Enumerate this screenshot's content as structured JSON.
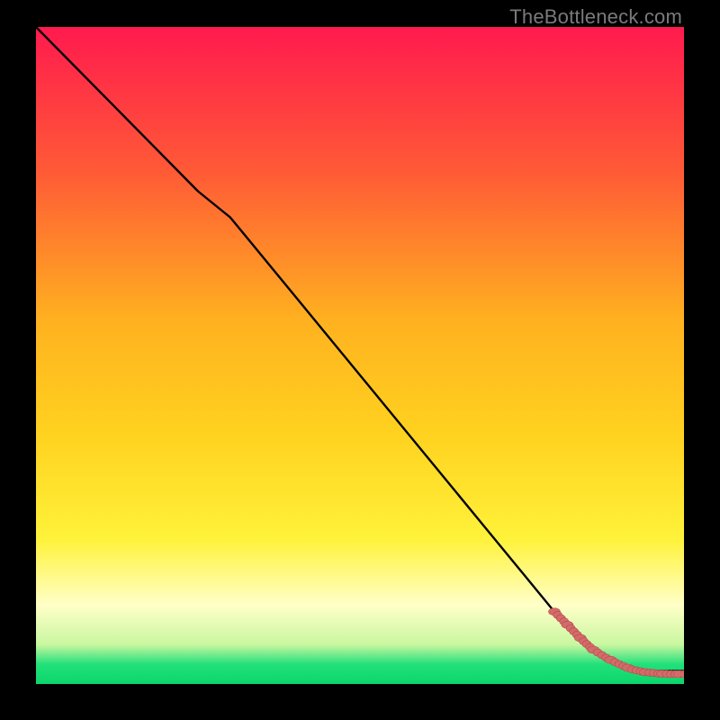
{
  "watermark": "TheBottleneck.com",
  "colors": {
    "bg": "#000000",
    "gradient_top": "#ff1a4e",
    "gradient_mid_upper": "#ff7a2a",
    "gradient_mid": "#ffd21f",
    "gradient_mid_lower": "#fff23a",
    "gradient_pale": "#ffffc8",
    "gradient_green": "#22e07a",
    "gradient_bottom": "#0bd66b",
    "line": "#000000",
    "marker_fill": "#d46a6a",
    "marker_stroke": "#b24c4c"
  },
  "chart_data": {
    "type": "line",
    "title": "",
    "xlabel": "",
    "ylabel": "",
    "xlim": [
      0,
      100
    ],
    "ylim": [
      0,
      100
    ],
    "grid": false,
    "legend": false,
    "series": [
      {
        "name": "curve",
        "x": [
          0,
          10,
          20,
          25,
          30,
          40,
          50,
          60,
          70,
          75,
          80,
          82,
          84,
          86,
          88,
          90,
          92,
          94,
          96,
          98,
          100
        ],
        "y": [
          100,
          90,
          80,
          75,
          71,
          59,
          47,
          35,
          23,
          17,
          11,
          9,
          7,
          5,
          4,
          3,
          2,
          2,
          2,
          2,
          2
        ]
      }
    ],
    "markers": {
      "name": "highlight-points",
      "x": [
        80,
        81.5,
        83,
        84.5,
        86,
        88,
        90,
        92,
        94,
        96,
        98,
        100
      ],
      "y": [
        11,
        9.5,
        8,
        6.5,
        5.2,
        4,
        3,
        2.2,
        1.8,
        1.6,
        1.5,
        1.5
      ]
    }
  }
}
